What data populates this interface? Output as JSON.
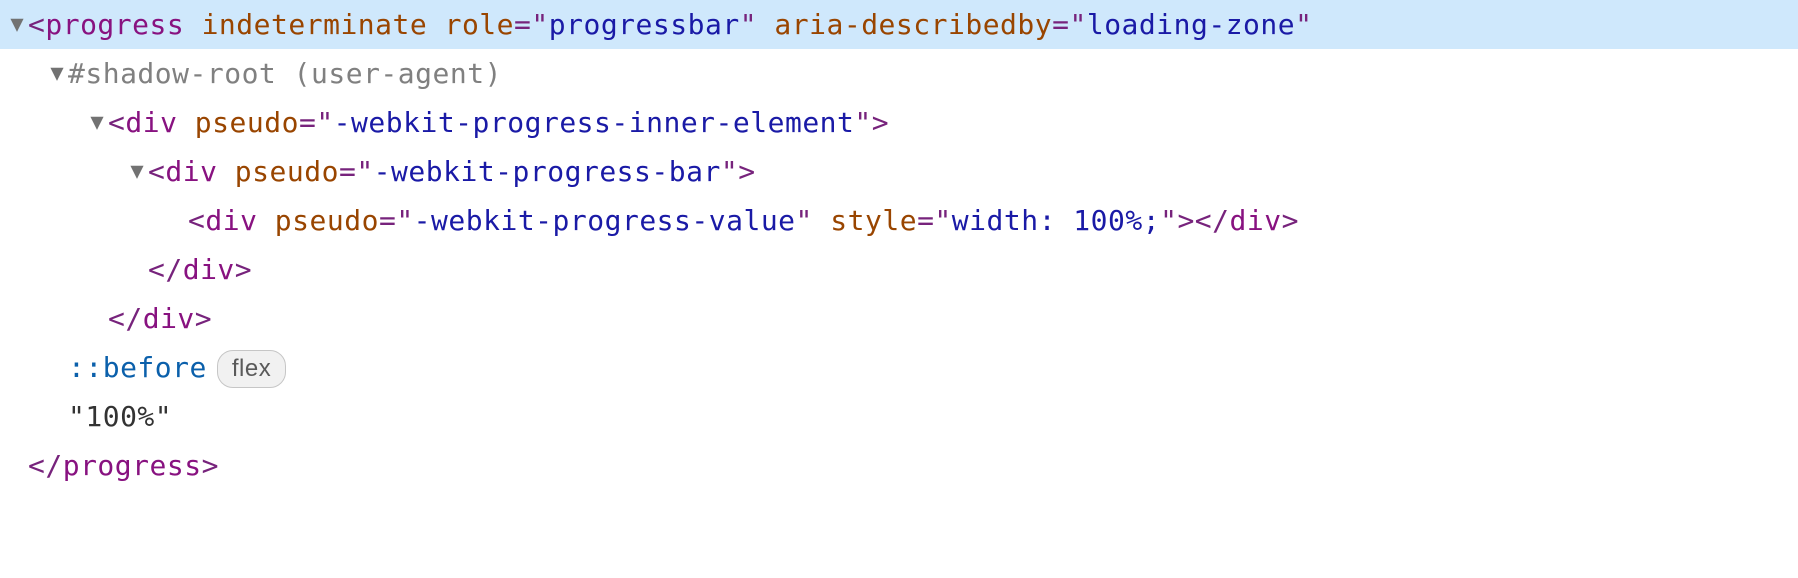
{
  "l1": {
    "tag": "progress",
    "a1n": "indeterminate",
    "a2n": "role",
    "a2v": "progressbar",
    "a3n": "aria-describedby",
    "a3v": "loading-zone"
  },
  "l2": {
    "text": "#shadow-root (user-agent)"
  },
  "l3": {
    "tag": "div",
    "a1n": "pseudo",
    "a1v": "-webkit-progress-inner-element"
  },
  "l4": {
    "tag": "div",
    "a1n": "pseudo",
    "a1v": "-webkit-progress-bar"
  },
  "l5": {
    "tag": "div",
    "a1n": "pseudo",
    "a1v": "-webkit-progress-value",
    "a2n": "style",
    "a2v": "width: 100%;",
    "close": "div"
  },
  "l6": {
    "close": "div"
  },
  "l7": {
    "close": "div"
  },
  "l8": {
    "pseudo": "::before",
    "badge": "flex"
  },
  "l9": {
    "text": "\"100%\""
  },
  "l10": {
    "close": "progress"
  }
}
